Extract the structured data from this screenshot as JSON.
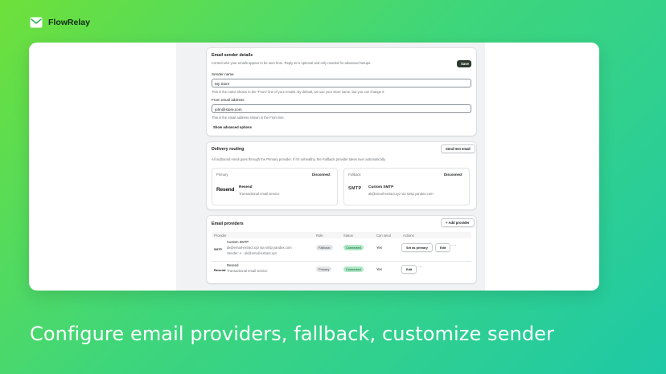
{
  "brand": {
    "name": "FlowRelay"
  },
  "sender": {
    "title": "Email sender details",
    "description": "Control who your emails appear to be sent from. Reply-to is optional and only needed for advanced setups.",
    "save_label": "Save",
    "name_label": "Sender name",
    "name_value": "My Store",
    "name_help": "This is the name shown in the \"From\" line of your emails. By default, we use your store name, but you can change it.",
    "email_label": "From email address",
    "email_value": "john@store.com",
    "email_help": "This is the email address shown in the From line.",
    "advanced_label": "Show advanced options"
  },
  "routing": {
    "title": "Delivery routing",
    "test_label": "Send test email",
    "description": "All outbound email goes through the Primary provider. If it's unhealthy, the Fallback provider takes over automatically.",
    "primary": {
      "heading": "Primary",
      "disconnect": "Disconnect",
      "logo": "Resend",
      "name": "Resend",
      "detail": "Transactional email service"
    },
    "fallback": {
      "heading": "Fallback",
      "disconnect": "Disconnect",
      "logo": "SMTP",
      "name": "Custom SMTP",
      "detail": "ak@email-extract.xyz via smtp.yandex.com"
    }
  },
  "providers": {
    "title": "Email providers",
    "add_label": "+ Add provider",
    "columns": [
      "Provider",
      "Role",
      "Status",
      "Can send",
      "Actions"
    ],
    "rows": [
      {
        "logo": "SMTP",
        "name": "Custom SMTP",
        "detail": "ak@email-extract.xyz via smtp.yandex.com",
        "detail2": "Sender: A · ak@email-extract.xyz",
        "role": "Fallback",
        "status": "Connected",
        "can_send": "Yes",
        "primary_action": "Set as primary",
        "edit": "Edit",
        "more": "···"
      },
      {
        "logo": "Resend",
        "name": "Resend",
        "detail": "Transactional email service",
        "role": "Primary",
        "status": "Connected",
        "can_send": "Yes",
        "edit": "Edit",
        "more": "···"
      }
    ]
  },
  "caption": "Configure email providers, fallback, customize sender",
  "colors": {
    "accent": "#2c3a2e",
    "success_bg": "#aee9c6",
    "success_text": "#0c5132"
  }
}
